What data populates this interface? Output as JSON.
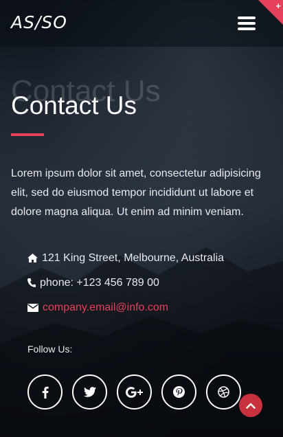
{
  "header": {
    "logo": "AS/SO",
    "menu_icon": "hamburger-menu-icon",
    "corner_icon": "plus-icon",
    "corner_label": "+"
  },
  "hero": {
    "ghost_title": "Contact Us",
    "title": "Contact Us",
    "description": "Lorem ipsum dolor sit amet, consectetur adipisicing elit, sed do eiusmod tempor incididunt ut labore et dolore magna aliqua. Ut enim ad minim veniam."
  },
  "contact": {
    "address": "121 King Street, Melbourne, Australia",
    "phone": "phone: +123 456 789 00",
    "email": "company.email@info.com"
  },
  "social": {
    "follow_label": "Follow Us:",
    "icons": [
      "facebook-icon",
      "twitter-icon",
      "google-plus-icon",
      "pinterest-icon",
      "dribbble-icon"
    ]
  },
  "colors": {
    "accent": "#e5405a",
    "back_to_top": "#c8323f"
  }
}
